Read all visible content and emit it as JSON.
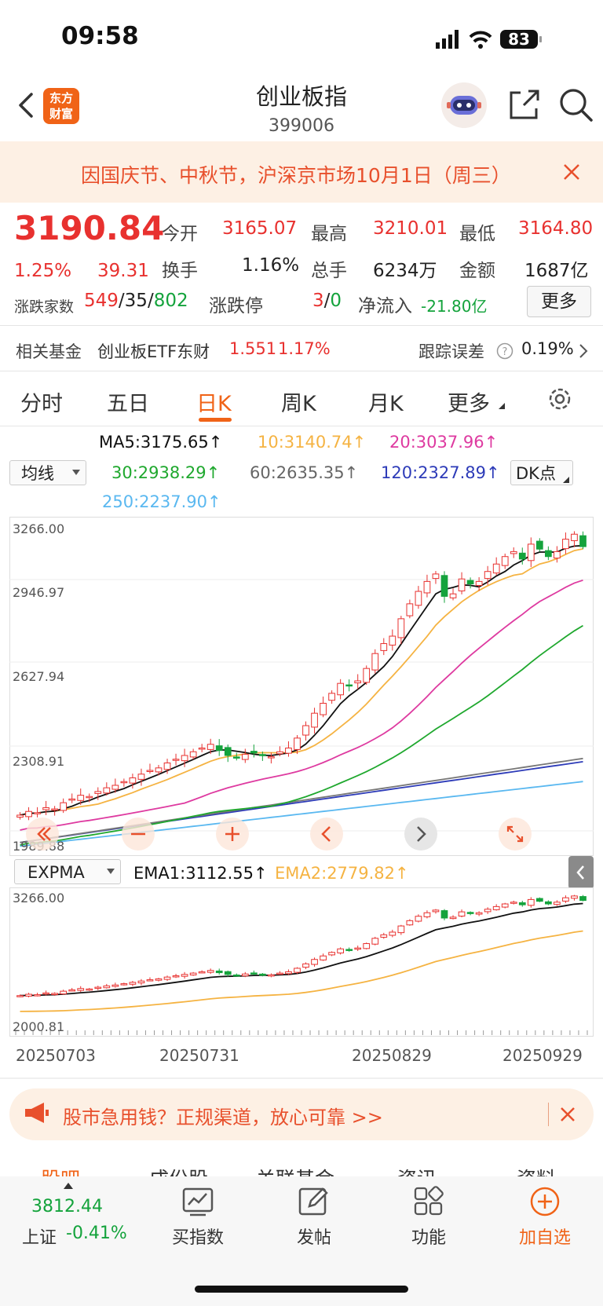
{
  "status_bar": {
    "time": "09:58",
    "battery": "83"
  },
  "header": {
    "logo_line1": "东方",
    "logo_line2": "财富",
    "title": "创业板指",
    "code": "399006"
  },
  "notice": {
    "text": "因国庆节、中秋节，沪深京市场10月1日（周三）"
  },
  "quote": {
    "price": "3190.84",
    "change_pct": "1.25%",
    "change": "39.31",
    "open_label": "今开",
    "open": "3165.07",
    "high_label": "最高",
    "high": "3210.01",
    "low_label": "最低",
    "low": "3164.80",
    "turnover_label": "换手",
    "turnover": "1.16%",
    "volume_label": "总手",
    "volume": "6234万",
    "amount_label": "金额",
    "amount": "1687亿",
    "breadth_label": "涨跌家数",
    "breadth_up": "549",
    "breadth_sep1": "/",
    "breadth_flat": "35",
    "breadth_sep2": "/",
    "breadth_down": "802",
    "limit_label": "涨跌停",
    "limit_up": "3",
    "limit_sep": "/",
    "limit_down": "0",
    "netflow_label": "净流入",
    "netflow": "-21.80亿",
    "more_label": "更多"
  },
  "fund": {
    "label": "相关基金",
    "name": "创业板ETF东财",
    "price": "1.551",
    "pct": "1.17%",
    "tracking_label": "跟踪误差",
    "tracking": "0.19%"
  },
  "tabs": [
    "分时",
    "五日",
    "日K",
    "周K",
    "月K",
    "更多"
  ],
  "ma_panel": {
    "ma5": "MA5:3175.65↑",
    "ma10": "10:3140.74↑",
    "ma20": "20:3037.96↑",
    "ma30": "30:2938.29↑",
    "ma60": "60:2635.35↑",
    "ma120": "120:2327.89↑",
    "ma250": "250:2237.90↑",
    "select": "均线",
    "dk": "DK点",
    "axis": [
      "3266.00",
      "2946.97",
      "2627.94",
      "2308.91",
      "1989.88"
    ]
  },
  "ema_panel": {
    "select": "EXPMA",
    "ema1": "EMA1:3112.55↑",
    "ema2": "EMA2:2779.82↑",
    "axis_top": "3266.00",
    "axis_bottom": "2000.81"
  },
  "dates": [
    "20250703",
    "20250731",
    "20250829",
    "20250929"
  ],
  "ad": {
    "text": "股市急用钱？正规渠道，放心可靠 >>"
  },
  "sub_tabs": [
    "股吧",
    "成份股",
    "关联基金",
    "资讯",
    "资料"
  ],
  "bottom": {
    "index_value": "3812.44",
    "index_name": "上证",
    "index_pct": "-0.41%",
    "nav": [
      "买指数",
      "发帖",
      "功能",
      "加自选"
    ]
  },
  "colors": {
    "up": "#e8312f",
    "down": "#14a33c",
    "accent": "#f06317",
    "ma5": "#111111",
    "ma10": "#f5b342",
    "ma20": "#de3aa0",
    "ma30": "#1fa82e",
    "ma60": "#777777",
    "ma120": "#2d3bb8",
    "ma250": "#5ab8f0"
  },
  "chart_data": {
    "type": "candlestick",
    "x_start": "20250703",
    "x_end": "20250930",
    "ylim": [
      1989.88,
      3266.0
    ],
    "ma_last": {
      "MA5": 3175.65,
      "MA10": 3140.74,
      "MA20": 3037.96,
      "MA30": 2938.29,
      "MA60": 2635.35,
      "MA120": 2327.89,
      "MA250": 2237.9
    },
    "ema_last": {
      "EMA1": 3112.55,
      "EMA2": 2779.82
    },
    "closes": [
      2110,
      2125,
      2120,
      2140,
      2135,
      2160,
      2175,
      2190,
      2185,
      2205,
      2220,
      2230,
      2245,
      2260,
      2275,
      2290,
      2300,
      2320,
      2335,
      2350,
      2365,
      2380,
      2395,
      2370,
      2350,
      2340,
      2355,
      2360,
      2350,
      2345,
      2365,
      2380,
      2420,
      2470,
      2520,
      2560,
      2600,
      2640,
      2630,
      2650,
      2700,
      2760,
      2800,
      2830,
      2900,
      2960,
      3010,
      3050,
      3080,
      2990,
      3000,
      3060,
      3040,
      3050,
      3090,
      3120,
      3150,
      3170,
      3140,
      3200,
      3180,
      3150,
      3170,
      3220,
      3240,
      3190
    ]
  }
}
